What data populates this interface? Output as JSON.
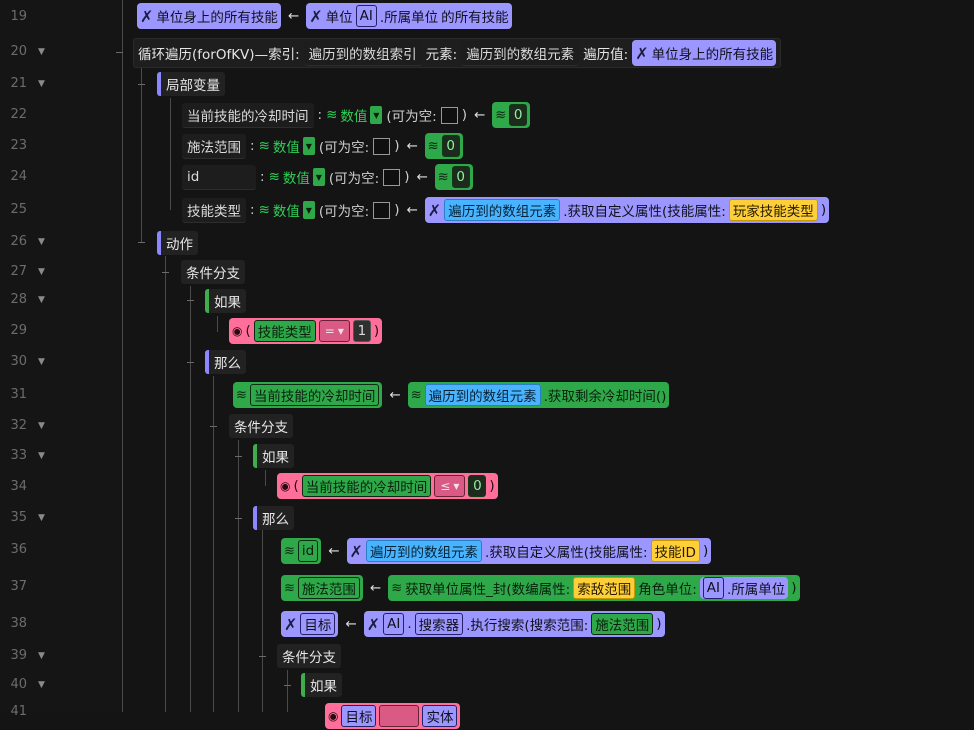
{
  "lines": [
    {
      "n": "19",
      "fold": false
    },
    {
      "n": "20",
      "fold": true
    },
    {
      "n": "21",
      "fold": true
    },
    {
      "n": "22",
      "fold": false
    },
    {
      "n": "23",
      "fold": false
    },
    {
      "n": "24",
      "fold": false
    },
    {
      "n": "25",
      "fold": false
    },
    {
      "n": "26",
      "fold": true
    },
    {
      "n": "27",
      "fold": true
    },
    {
      "n": "28",
      "fold": true
    },
    {
      "n": "29",
      "fold": false
    },
    {
      "n": "30",
      "fold": true
    },
    {
      "n": "31",
      "fold": false
    },
    {
      "n": "32",
      "fold": true
    },
    {
      "n": "33",
      "fold": true
    },
    {
      "n": "34",
      "fold": false
    },
    {
      "n": "35",
      "fold": true
    },
    {
      "n": "36",
      "fold": false
    },
    {
      "n": "37",
      "fold": false
    },
    {
      "n": "38",
      "fold": false
    },
    {
      "n": "39",
      "fold": true
    },
    {
      "n": "40",
      "fold": true
    },
    {
      "n": "41",
      "fold": false
    }
  ],
  "fold_glyph": "▼",
  "collapse_glyph": "−",
  "arrow": "←",
  "colon": ":",
  "dropdown_caret": "▾",
  "paren_open": "(",
  "paren_close": ")",
  "l19": {
    "left": "单位身上的所有技能",
    "unit": "单位",
    "ai": "AI",
    "prop": ".所属单位",
    "tail": "的所有技能"
  },
  "l20": {
    "loop": "循环遍历(forOfKV)—索引:",
    "index": "遍历到的数组索引",
    "elem_label": "元素:",
    "elem": "遍历到的数组元素",
    "val_label": "遍历值:",
    "val": "单位身上的所有技能"
  },
  "l21": {
    "label": "局部变量"
  },
  "locals": [
    {
      "name": "当前技能的冷却时间",
      "type": "数值",
      "nullable": "(可为空:",
      "close": ")",
      "value": "0"
    },
    {
      "name": "施法范围",
      "type": "数值",
      "nullable": "(可为空:",
      "close": ")",
      "value": "0"
    },
    {
      "name": "id",
      "type": "数值",
      "nullable": "(可为空:",
      "close": ")",
      "value": "0"
    },
    {
      "name": "技能类型",
      "type": "数值",
      "nullable": "(可为空:",
      "close": ")"
    }
  ],
  "l25": {
    "elem": "遍历到的数组元素",
    "method": ".获取自定义属性(技能属性:",
    "attr": "玩家技能类型"
  },
  "l26": {
    "label": "动作"
  },
  "l27": {
    "label": "条件分支"
  },
  "l28": {
    "label": "如果"
  },
  "l29": {
    "var": "技能类型",
    "op": "=",
    "value": "1"
  },
  "l30": {
    "label": "那么"
  },
  "l31": {
    "var": "当前技能的冷却时间",
    "elem": "遍历到的数组元素",
    "method": ".获取剩余冷却时间()"
  },
  "l32": {
    "label": "条件分支"
  },
  "l33": {
    "label": "如果"
  },
  "l34": {
    "var": "当前技能的冷却时间",
    "op": "≤",
    "value": "0"
  },
  "l35": {
    "label": "那么"
  },
  "l36": {
    "var": "id",
    "elem": "遍历到的数组元素",
    "method": ".获取自定义属性(技能属性:",
    "attr": "技能ID"
  },
  "l37": {
    "var": "施法范围",
    "fn": "获取单位属性_封(数编属性:",
    "attr": "索敌范围",
    "role": "角色单位:",
    "ai": "AI",
    "prop": ".所属单位"
  },
  "l38": {
    "var": "目标",
    "ai": "AI",
    "dot": ".",
    "searcher": "搜索器",
    "method": ".执行搜索(搜索范围:",
    "arg": "施法范围"
  },
  "l39": {
    "label": "条件分支"
  },
  "l40": {
    "label": "如果"
  },
  "l41": {
    "var": "目标",
    "rest": "实体"
  }
}
